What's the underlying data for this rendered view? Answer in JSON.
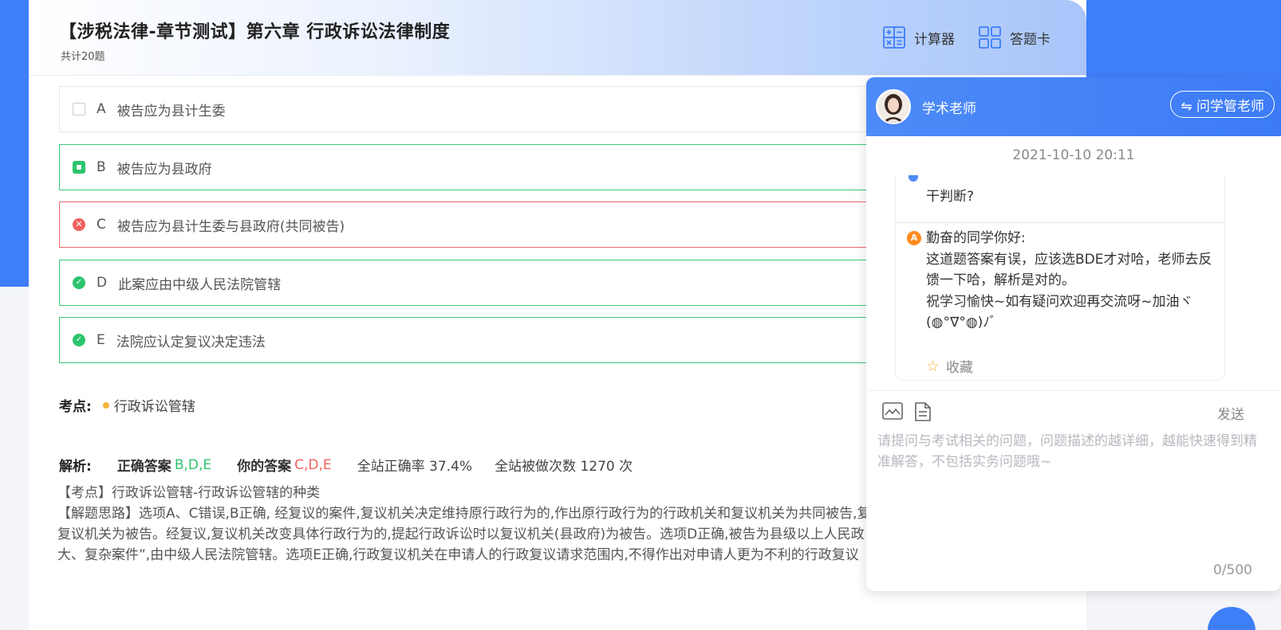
{
  "header": {
    "title": "【涉税法律-章节测试】第六章 行政诉讼法律制度",
    "subtitle": "共计20题",
    "calculator_label": "计算器",
    "answer_card_label": "答题卡"
  },
  "options": [
    {
      "letter": "A",
      "text": "被告应为县计生委",
      "state": "unselected"
    },
    {
      "letter": "B",
      "text": "被告应为县政府",
      "state": "correct-unchosen"
    },
    {
      "letter": "C",
      "text": "被告应为县计生委与县政府(共同被告)",
      "state": "wrong-chosen"
    },
    {
      "letter": "D",
      "text": "此案应由中级人民法院管辖",
      "state": "correct-chosen"
    },
    {
      "letter": "E",
      "text": "法院应认定复议决定违法",
      "state": "correct-chosen"
    }
  ],
  "kaodian": {
    "label": "考点:",
    "value": "行政诉讼管辖"
  },
  "jiexi": {
    "label": "解析:",
    "correct_label": "正确答案",
    "correct_value": "B,D,E",
    "yours_label": "你的答案",
    "yours_value": "C,D,E",
    "rate_text": "全站正确率 37.4%",
    "count_text": "全站被做次数 1270 次"
  },
  "analysis": {
    "lines": [
      "【考点】行政诉讼管辖-行政诉讼管辖的种类",
      "【解题思路】选项A、C错误,B正确, 经复议的案件,复议机关决定维持原行政行为的,作出原行政行为的行政机关和复议机关为共同被告,复",
      "复议机关为被告。经复议,复议机关改变具体行政行为的,提起行政诉讼时以复议机关(县政府)为被告。选项D正确,被告为县级以上人民政",
      "大、复杂案件”,由中级人民法院管辖。选项E正确,行政复议机关在申请人的行政复议请求范围内,不得作出对申请人更为不利的行政复议"
    ]
  },
  "chat": {
    "teacher_name": "学术老师",
    "ask_button": "⇋ 问学管老师",
    "time": "2021-10-10 20:11",
    "prev_message": "干判断?",
    "answer_icon": "A",
    "answer_lines": [
      "勤奋的同学你好:",
      "这道题答案有误，应该选BDE才对哈，老师去反馈一下哈，解析是对的。",
      "祝学习愉快~如有疑问欢迎再交流呀~加油ヾ(◍°∇°◍)ﾉﾞ"
    ],
    "favorite_label": "收藏",
    "send_label": "发送",
    "placeholder": "请提问与考试相关的问题，问题描述的越详细，越能快速得到精准解答，不包括实务问题哦~",
    "counter": "0/500"
  },
  "icons": {
    "calculator": "calculator-icon",
    "answer_card": "grid-icon",
    "image": "image-icon",
    "document": "document-icon",
    "star": "star-icon",
    "swap": "swap-icon"
  },
  "colors": {
    "brand_blue": "#3e7ef8",
    "correct_green": "#2cc46d",
    "wrong_red": "#f0605e",
    "keypoint_dot": "#f7b23b"
  }
}
